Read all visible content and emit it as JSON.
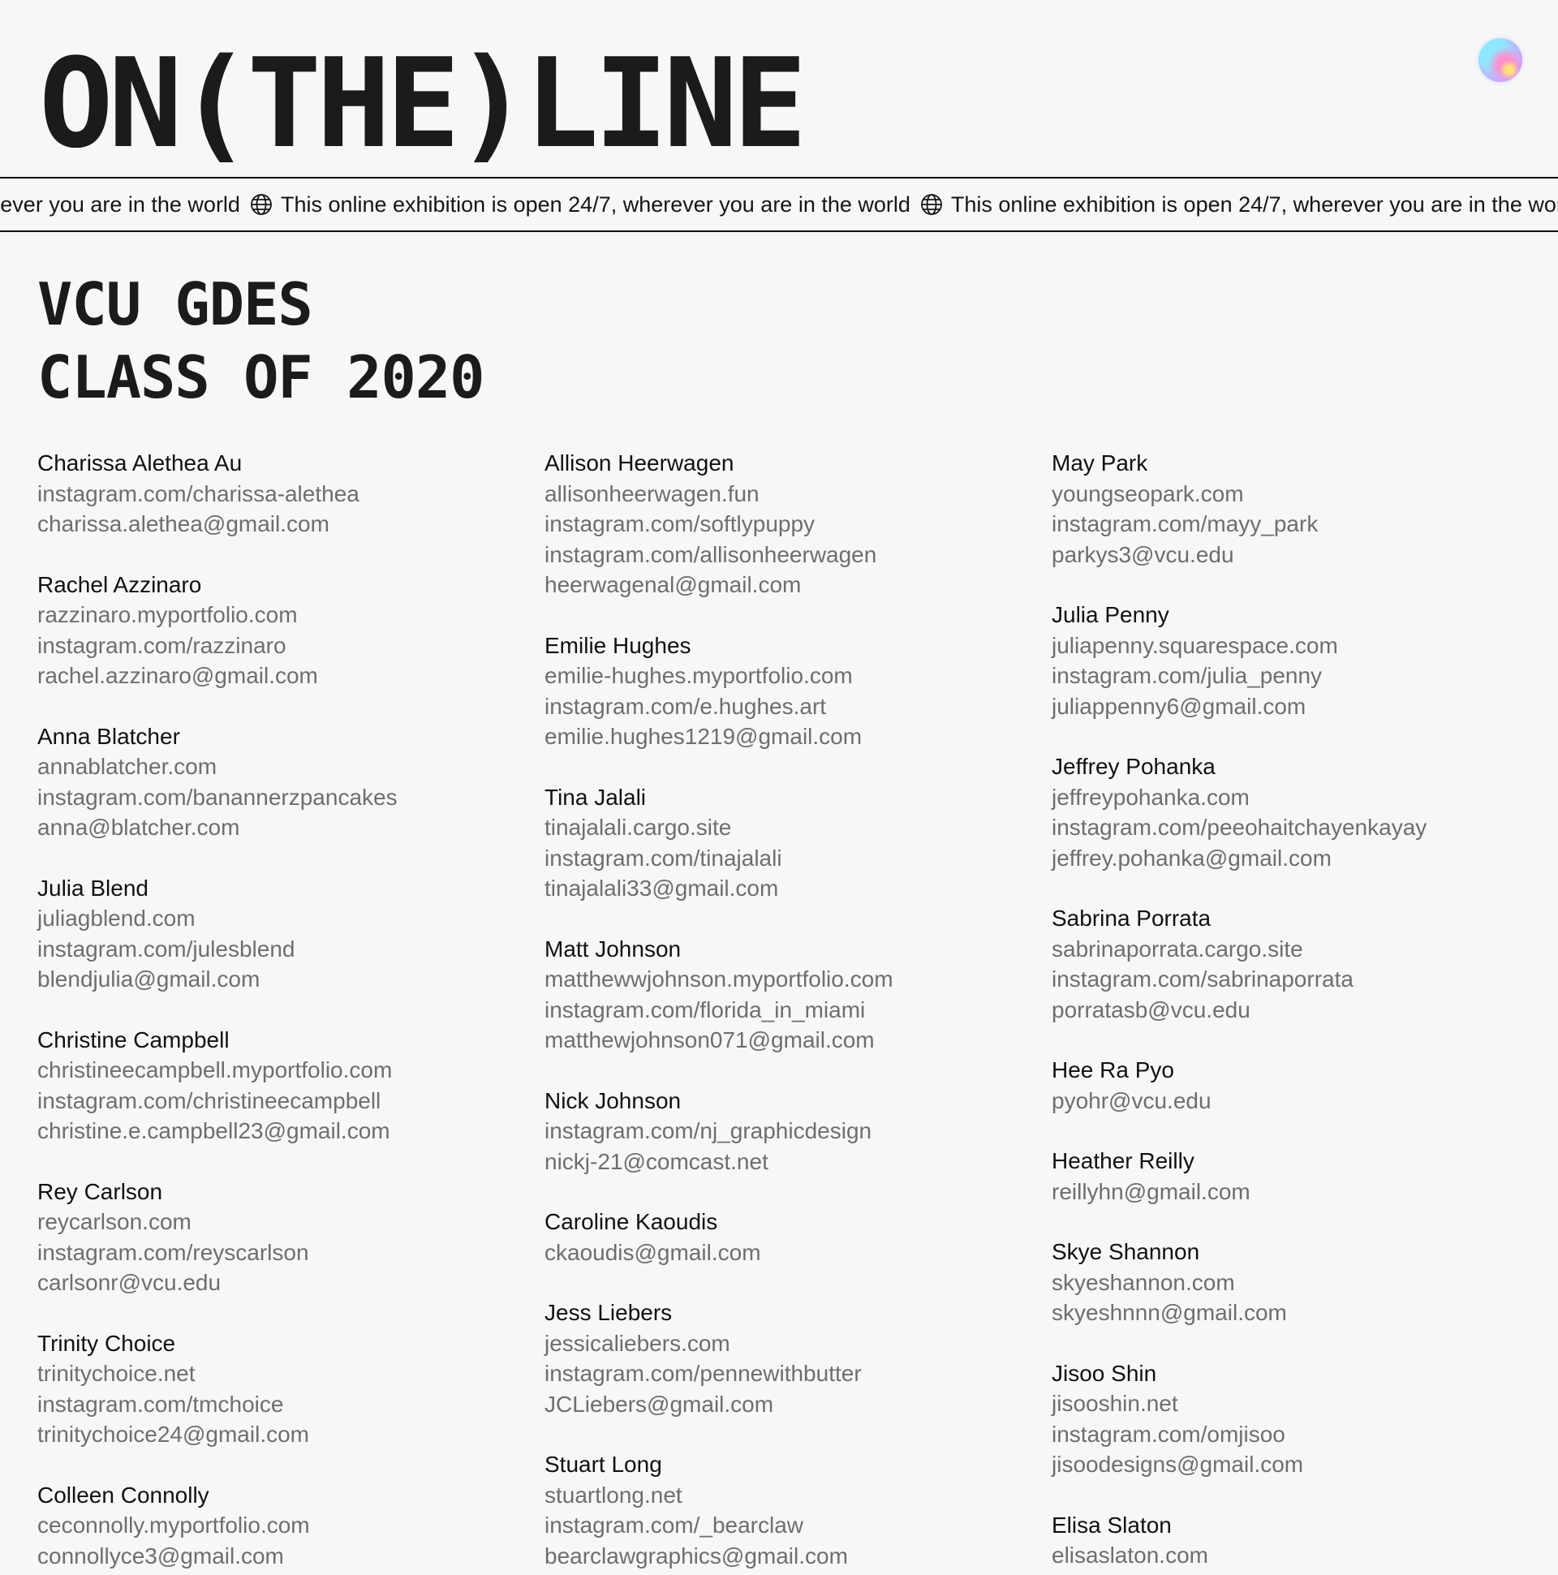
{
  "header": {
    "logo_text": "ON(THE)LINE"
  },
  "marquee": {
    "text": "This online exhibition is open 24/7, wherever you are in the world",
    "icon": "globe-icon"
  },
  "title": {
    "line1": "VCU GDES",
    "line2": "CLASS OF 2020"
  },
  "columns": [
    [
      {
        "name": "Charissa Alethea Au",
        "links": [
          "instagram.com/charissa-alethea",
          "charissa.alethea@gmail.com"
        ]
      },
      {
        "name": "Rachel Azzinaro",
        "links": [
          "razzinaro.myportfolio.com",
          "instagram.com/razzinaro",
          "rachel.azzinaro@gmail.com"
        ]
      },
      {
        "name": "Anna Blatcher",
        "links": [
          "annablatcher.com",
          "instagram.com/banannerzpancakes",
          "anna@blatcher.com"
        ]
      },
      {
        "name": "Julia Blend",
        "links": [
          "juliagblend.com",
          "instagram.com/julesblend",
          "blendjulia@gmail.com"
        ]
      },
      {
        "name": "Christine Campbell",
        "links": [
          "christineecampbell.myportfolio.com",
          "instagram.com/christineecampbell",
          "christine.e.campbell23@gmail.com"
        ]
      },
      {
        "name": "Rey Carlson",
        "links": [
          "reycarlson.com",
          "instagram.com/reyscarlson",
          "carlsonr@vcu.edu"
        ]
      },
      {
        "name": "Trinity Choice",
        "links": [
          "trinitychoice.net",
          "instagram.com/tmchoice",
          "trinitychoice24@gmail.com"
        ]
      },
      {
        "name": "Colleen Connolly",
        "links": [
          "ceconnolly.myportfolio.com",
          "connollyce3@gmail.com"
        ]
      }
    ],
    [
      {
        "name": "Allison Heerwagen",
        "links": [
          "allisonheerwagen.fun",
          "instagram.com/softlypuppy",
          "instagram.com/allisonheerwagen",
          "heerwagenal@gmail.com"
        ]
      },
      {
        "name": "Emilie Hughes",
        "links": [
          "emilie-hughes.myportfolio.com",
          "instagram.com/e.hughes.art",
          "emilie.hughes1219@gmail.com"
        ]
      },
      {
        "name": "Tina Jalali",
        "links": [
          "tinajalali.cargo.site",
          "instagram.com/tinajalali",
          "tinajalali33@gmail.com"
        ]
      },
      {
        "name": "Matt Johnson",
        "links": [
          "matthewwjohnson.myportfolio.com",
          "instagram.com/florida_in_miami",
          "matthewjohnson071@gmail.com"
        ]
      },
      {
        "name": "Nick Johnson",
        "links": [
          "instagram.com/nj_graphicdesign",
          "nickj-21@comcast.net"
        ]
      },
      {
        "name": "Caroline Kaoudis",
        "links": [
          "ckaoudis@gmail.com"
        ]
      },
      {
        "name": "Jess Liebers",
        "links": [
          "jessicaliebers.com",
          "instagram.com/pennewithbutter",
          "JCLiebers@gmail.com"
        ]
      },
      {
        "name": "Stuart Long",
        "links": [
          "stuartlong.net",
          "instagram.com/_bearclaw",
          "bearclawgraphics@gmail.com"
        ]
      }
    ],
    [
      {
        "name": "May Park",
        "links": [
          "youngseopark.com",
          "instagram.com/mayy_park",
          "parkys3@vcu.edu"
        ]
      },
      {
        "name": "Julia Penny",
        "links": [
          "juliapenny.squarespace.com",
          "instagram.com/julia_penny",
          "juliappenny6@gmail.com"
        ]
      },
      {
        "name": "Jeffrey Pohanka",
        "links": [
          "jeffreypohanka.com",
          "instagram.com/peeohaitchayenkayay",
          "jeffrey.pohanka@gmail.com"
        ]
      },
      {
        "name": "Sabrina Porrata",
        "links": [
          "sabrinaporrata.cargo.site",
          "instagram.com/sabrinaporrata",
          "porratasb@vcu.edu"
        ]
      },
      {
        "name": "Hee Ra Pyo",
        "links": [
          "pyohr@vcu.edu"
        ]
      },
      {
        "name": "Heather Reilly",
        "links": [
          "reillyhn@gmail.com"
        ]
      },
      {
        "name": "Skye Shannon",
        "links": [
          "skyeshannon.com",
          "skyeshnnn@gmail.com"
        ]
      },
      {
        "name": "Jisoo Shin",
        "links": [
          "jisooshin.net",
          "instagram.com/omjisoo",
          "jisoodesigns@gmail.com"
        ]
      },
      {
        "name": "Elisa Slaton",
        "links": [
          "elisaslaton.com"
        ]
      }
    ]
  ]
}
